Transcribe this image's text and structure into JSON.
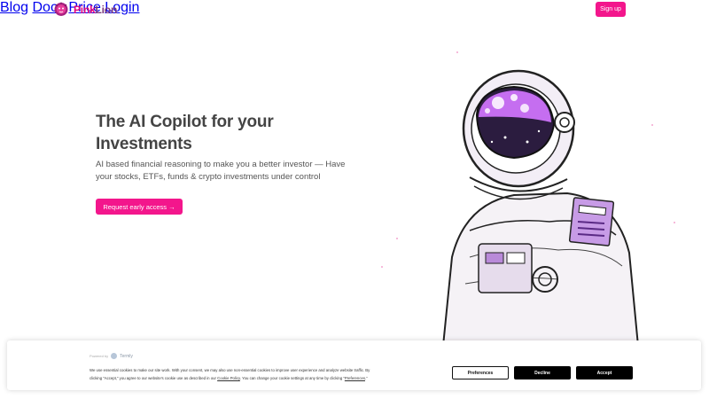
{
  "brand": {
    "name_primary": "Pink",
    "name_secondary": "Lion",
    "accent": "#f3168c"
  },
  "nav": {
    "blog": "Blog",
    "docs": "Docs",
    "price": "Price",
    "signup": "Sign up",
    "login": "Login"
  },
  "hero": {
    "title_line1": "The AI Copilot for your",
    "title_line2": "Investments",
    "subtitle_line1": "AI based financial reasoning to make you a better investor — Have",
    "subtitle_line2": "your stocks, ETFs, funds & crypto investments under control",
    "cta": "Request early access →",
    "illustration": "astronaut-illustration"
  },
  "cookie_banner": {
    "powered_by": "Powered by",
    "provider": "Termly",
    "text_line1": "We use essential cookies to make our site work. With your consent, we may also use non-essential cookies to improve user experience and analyze website traffic. By",
    "text_line2_a": "clicking “Accept,” you agree to our website's cookie use as described in our ",
    "cookie_policy_link": "Cookie Policy",
    "text_line2_b": ". You can change your cookie settings at any time by clicking “",
    "preferences_link": "Preferences",
    "text_line2_c": ".”",
    "preferences_button": "Preferences",
    "decline_button": "Decline",
    "accept_button": "Accept"
  }
}
